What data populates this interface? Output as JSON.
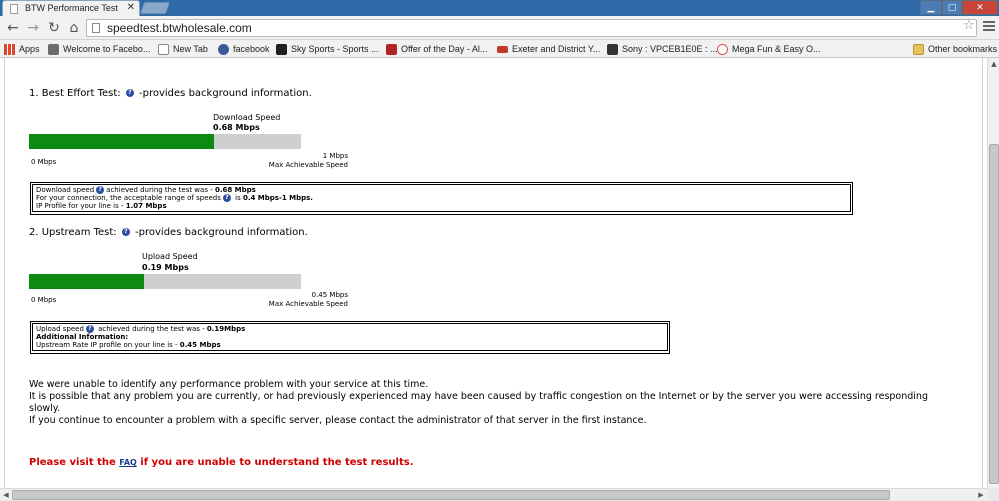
{
  "browser": {
    "tab_title": "BTW Performance Test",
    "tab_close": "✕",
    "url": "speedtest.btwholesale.com",
    "icons": {
      "back": "back-arrow-icon",
      "forward": "forward-arrow-icon",
      "reload": "reload-icon",
      "home": "home-icon",
      "star": "star-icon",
      "menu": "menu-icon"
    }
  },
  "bookmarks": {
    "items": [
      {
        "label": "Apps",
        "color": "#d9482b"
      },
      {
        "label": "Welcome to Facebo...",
        "color": "#6b6b6b"
      },
      {
        "label": "New Tab",
        "color": "#ffffff"
      },
      {
        "label": "facebook",
        "color": "#3b5998"
      },
      {
        "label": "Sky Sports - Sports ...",
        "color": "#1f1f1f"
      },
      {
        "label": "Offer of the Day - Al...",
        "color": "#b22222"
      },
      {
        "label": "Exeter and District Y...",
        "color": "#c0392b"
      },
      {
        "label": "Sony : VPCEB1E0E : ...",
        "color": "#333333"
      },
      {
        "label": "Mega Fun & Easy O...",
        "color": "#d35454"
      }
    ],
    "other": "Other bookmarks"
  },
  "best_effort": {
    "title_prefix": "1. Best Effort Test:",
    "title_suffix": "-provides background information.",
    "meter_caption": "Download  Speed",
    "meter_value": "0.68 Mbps",
    "fill_fraction": 0.68,
    "scale_min": "0 Mbps",
    "scale_max_value": "1 Mbps",
    "scale_max_caption": "Max Achievable Speed",
    "info_line1_prefix": "Download speed",
    "info_line1_mid": "achieved during the test was - ",
    "info_line1_value": "0.68 Mbps",
    "info_line2_prefix": "For your connection, the acceptable range of speeds",
    "info_line2_mid": " is ",
    "info_line2_value": "0.4 Mbps-1 Mbps.",
    "info_line3_prefix": "IP Profile for your line is - ",
    "info_line3_value": "1.07 Mbps"
  },
  "upstream": {
    "title_prefix": "2. Upstream Test:",
    "title_suffix": "-provides background information.",
    "meter_caption": "Upload Speed",
    "meter_value": "0.19 Mbps",
    "fill_fraction": 0.4222,
    "scale_min": "0 Mbps",
    "scale_max_value": "0.45 Mbps",
    "scale_max_caption": "Max Achievable Speed",
    "info_line1_prefix": "Upload speed",
    "info_line1_mid": " achieved during the test was - ",
    "info_line1_value": "0.19Mbps",
    "info_line2": "Additional Information:",
    "info_line3_prefix": "Upstream Rate IP profile on your line is - ",
    "info_line3_value": "0.45 Mbps"
  },
  "messages": {
    "line1": "We were unable to identify any performance problem with your service at this time.",
    "line2": "It is possible that any problem you are currently, or had previously experienced may have been caused by traffic congestion on the Internet or by the server you were accessing responding slowly.",
    "line3": "If you continue to encounter a problem with a specific server, please contact the administrator of that server in the first instance.",
    "faq_prefix": "Please visit the ",
    "faq_link": "FAQ",
    "faq_suffix": " if you are unable to understand the test results."
  }
}
